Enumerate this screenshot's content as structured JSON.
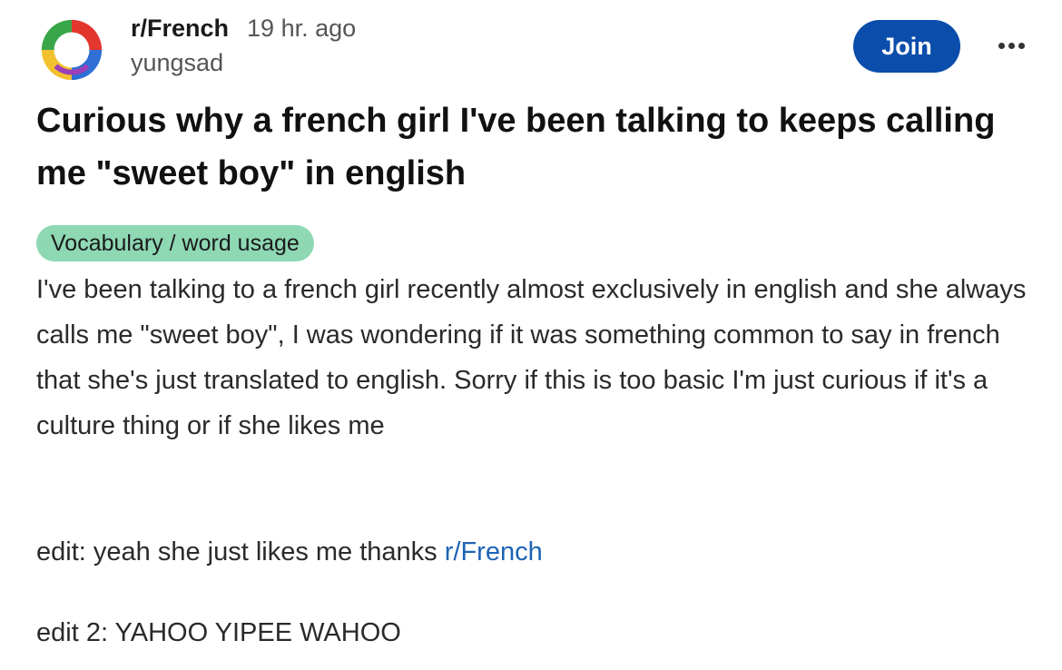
{
  "header": {
    "subreddit": "r/French",
    "time_ago": "19 hr. ago",
    "username": "yungsad",
    "join_label": "Join",
    "avatar_icon": "subreddit-logo-icon",
    "more_icon": "more-options-icon"
  },
  "post": {
    "title": "Curious why a french girl I've been talking to keeps calling me \"sweet boy\" in english",
    "flair": "Vocabulary / word usage",
    "body": "I've been talking to a french girl recently almost exclusively in english and she always calls me \"sweet boy\", I was wondering if it was something common to say in french that she's just translated to english. Sorry if this is too basic I'm just curious if it's a culture thing or if she likes me",
    "edit1_text": "edit: yeah she just likes me thanks ",
    "edit1_link": "r/French",
    "edit2": "edit 2: YAHOO YIPEE WAHOO"
  },
  "colors": {
    "join_button": "#0b4dab",
    "flair_background": "#8ed8b4",
    "link": "#1e63b5"
  }
}
